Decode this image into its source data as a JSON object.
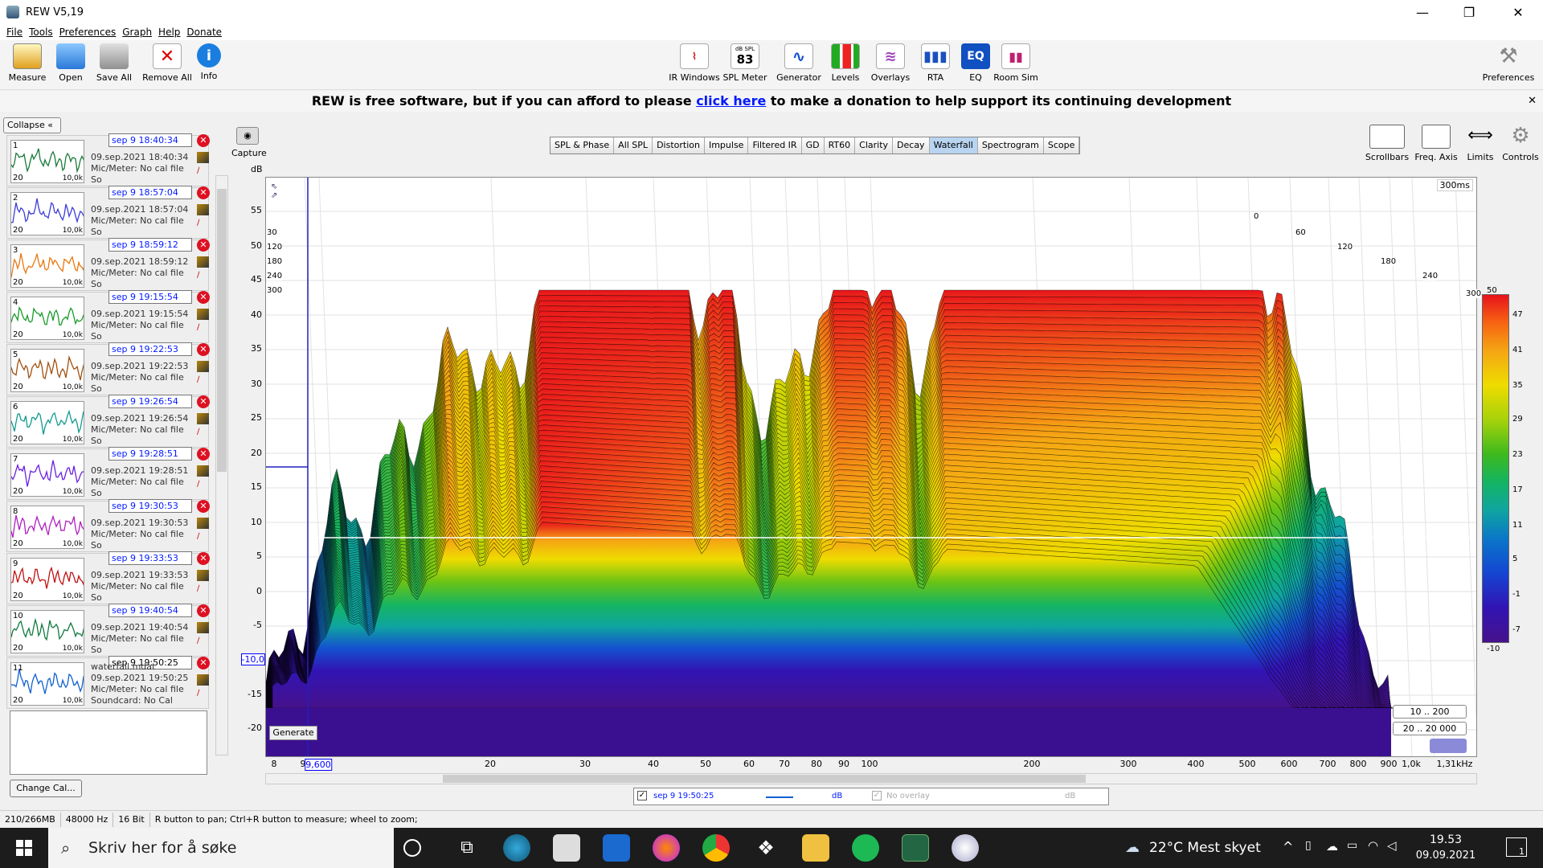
{
  "window": {
    "title": "REW V5,19",
    "min": "—",
    "max": "❐",
    "close": "✕"
  },
  "menu": [
    "File",
    "Tools",
    "Preferences",
    "Graph",
    "Help",
    "Donate"
  ],
  "toolbar_left": [
    {
      "label": "Measure",
      "icon": "measure-icon"
    },
    {
      "label": "Open",
      "icon": "folder-icon"
    },
    {
      "label": "Save All",
      "icon": "save-icon"
    },
    {
      "label": "Remove All",
      "icon": "remove-icon"
    },
    {
      "label": "Info",
      "icon": "info-icon"
    }
  ],
  "toolbar_center": [
    {
      "label": "IR Windows",
      "icon": "ir-windows-icon"
    },
    {
      "label": "SPL Meter",
      "icon": "spl-meter-icon",
      "value": "83",
      "unit": "dB SPL"
    },
    {
      "label": "Generator",
      "icon": "generator-icon"
    },
    {
      "label": "Levels",
      "icon": "levels-icon"
    },
    {
      "label": "Overlays",
      "icon": "overlays-icon"
    },
    {
      "label": "RTA",
      "icon": "rta-icon"
    },
    {
      "label": "EQ",
      "icon": "eq-icon"
    },
    {
      "label": "Room Sim",
      "icon": "room-sim-icon"
    }
  ],
  "toolbar_right": {
    "label": "Preferences",
    "icon": "wrench-icon"
  },
  "donate": {
    "before": "REW is free software, but if you can afford to please ",
    "link": "click here",
    "after": " to make a donation to help support its continuing development",
    "close": "✕"
  },
  "panel": {
    "collapse": "Collapse",
    "change_cal": "Change Cal...",
    "measurements": [
      {
        "num": "1",
        "name": "sep 9 18:40:34",
        "date": "09.sep.2021 18:40:34",
        "mic": "Mic/Meter: No cal file",
        "sc": "So",
        "color": "#1a7a3a"
      },
      {
        "num": "2",
        "name": "sep 9 18:57:04",
        "date": "09.sep.2021 18:57:04",
        "mic": "Mic/Meter: No cal file",
        "sc": "So",
        "color": "#3c3cd8"
      },
      {
        "num": "3",
        "name": "sep 9 18:59:12",
        "date": "09.sep.2021 18:59:12",
        "mic": "Mic/Meter: No cal file",
        "sc": "So",
        "color": "#e87810"
      },
      {
        "num": "4",
        "name": "sep 9 19:15:54",
        "date": "09.sep.2021 19:15:54",
        "mic": "Mic/Meter: No cal file",
        "sc": "So",
        "color": "#1a9a2a"
      },
      {
        "num": "5",
        "name": "sep 9 19:22:53",
        "date": "09.sep.2021 19:22:53",
        "mic": "Mic/Meter: No cal file",
        "sc": "So",
        "color": "#a05010"
      },
      {
        "num": "6",
        "name": "sep 9 19:26:54",
        "date": "09.sep.2021 19:26:54",
        "mic": "Mic/Meter: No cal file",
        "sc": "So",
        "color": "#109a90"
      },
      {
        "num": "7",
        "name": "sep 9 19:28:51",
        "date": "09.sep.2021 19:28:51",
        "mic": "Mic/Meter: No cal file",
        "sc": "So",
        "color": "#6a20e0"
      },
      {
        "num": "8",
        "name": "sep 9 19:30:53",
        "date": "09.sep.2021 19:30:53",
        "mic": "Mic/Meter: No cal file",
        "sc": "So",
        "color": "#b020c0"
      },
      {
        "num": "9",
        "name": "sep 9 19:33:53",
        "date": "09.sep.2021 19:33:53",
        "mic": "Mic/Meter: No cal file",
        "sc": "So",
        "color": "#c01010"
      },
      {
        "num": "10",
        "name": "sep 9 19:40:54",
        "date": "09.sep.2021 19:40:54",
        "mic": "Mic/Meter: No cal file",
        "sc": "So",
        "color": "#107a40"
      },
      {
        "num": "11",
        "name": "sep 9 19:50:25",
        "date": "09.sep.2021 19:50:25",
        "file": "waterfall.mdat",
        "mic": "Mic/Meter: No cal file",
        "sc": "Soundcard: No Cal",
        "color": "#1060d0"
      }
    ],
    "thumb_low": "20",
    "thumb_high": "10,0k"
  },
  "capture": "Capture",
  "tabs": [
    "SPL & Phase",
    "All SPL",
    "Distortion",
    "Impulse",
    "Filtered IR",
    "GD",
    "RT60",
    "Clarity",
    "Decay",
    "Waterfall",
    "Spectrogram",
    "Scope"
  ],
  "active_tab": "Waterfall",
  "right_tools": [
    "Scrollbars",
    "Freq. Axis",
    "Limits",
    "Controls"
  ],
  "graph": {
    "y_unit": "dB",
    "y_ticks": [
      "55",
      "50",
      "45",
      "40",
      "35",
      "30",
      "25",
      "20",
      "15",
      "10",
      "5",
      "0",
      "-5",
      "-10,0",
      "-15",
      "-20"
    ],
    "x_ticks": [
      "8",
      "9",
      "9,600",
      "20",
      "30",
      "40",
      "50",
      "60",
      "70",
      "80",
      "90",
      "100",
      "200",
      "300",
      "400",
      "500",
      "600",
      "700",
      "800",
      "900",
      "1,0k",
      "1,31kHz"
    ],
    "time_label": "300ms",
    "time_ticks": [
      "0",
      "60",
      "120",
      "180",
      "240",
      "300"
    ],
    "left_time_ticks": [
      "30",
      "120",
      "180",
      "240",
      "300"
    ],
    "generate": "Generate",
    "range1": "10 .. 200",
    "range2": "20 .. 20 000"
  },
  "colorbar": {
    "ticks": [
      "50",
      "47",
      "41",
      "35",
      "29",
      "23",
      "17",
      "11",
      "5",
      "-1",
      "-7",
      "-10"
    ]
  },
  "legend": {
    "name": "sep 9 19:50:25",
    "unit": "dB",
    "overlay": "No overlay",
    "overlay_unit": "dB"
  },
  "status": [
    "210/266MB",
    "48000 Hz",
    "16 Bit",
    "R button to pan; Ctrl+R button to measure; wheel to zoom;"
  ],
  "taskbar": {
    "search": "Skriv her for å søke",
    "weather": "22°C  Mest skyet",
    "time": "19.53",
    "date": "09.09.2021",
    "notif": "1"
  },
  "colors": {
    "accent": "#0019ff",
    "active_tab": "#b8d4f0"
  }
}
